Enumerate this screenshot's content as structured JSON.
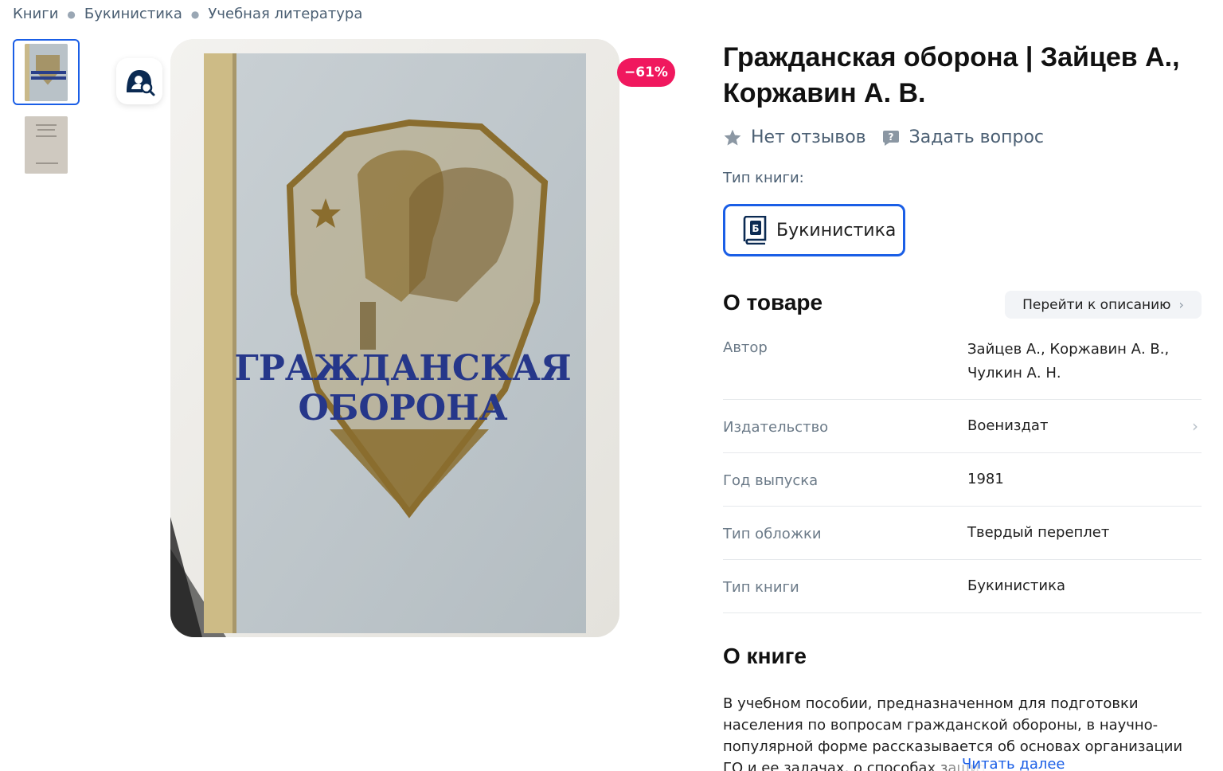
{
  "breadcrumb": [
    "Книги",
    "Букинистика",
    "Учебная литература"
  ],
  "gallery": {
    "discount": "−61%",
    "cover_title_line1": "ГРАЖДАНСКАЯ",
    "cover_title_line2": "ОБОРОНА"
  },
  "product": {
    "title": "Гражданская оборона | Зайцев А., Коржавин А. В.",
    "reviews_label": "Нет отзывов",
    "ask_label": "Задать вопрос",
    "type_label": "Тип книги:",
    "type_value": "Букинистика"
  },
  "about_product": {
    "heading": "О товаре",
    "goto_label": "Перейти к описанию",
    "props": [
      {
        "key": "Автор",
        "value": "Зайцев А., Коржавин А. В., Чулкин А. Н."
      },
      {
        "key": "Издательство",
        "value": "Воениздат"
      },
      {
        "key": "Год выпуска",
        "value": "1981"
      },
      {
        "key": "Тип обложки",
        "value": "Твердый переплет"
      },
      {
        "key": "Тип книги",
        "value": "Букинистика"
      }
    ]
  },
  "about_book": {
    "heading": "О книге",
    "text": "В учебном пособии, предназначенном для подготовки населения по вопросам гражданской обороны, в научно-популярной форме рассказывается об основах организации ГО и ее задачах, о способах защиты",
    "read_more": "Читать далее"
  },
  "colors": {
    "accent": "#1a5ee6",
    "discount": "#f0185e",
    "muted": "#4b5f73"
  }
}
